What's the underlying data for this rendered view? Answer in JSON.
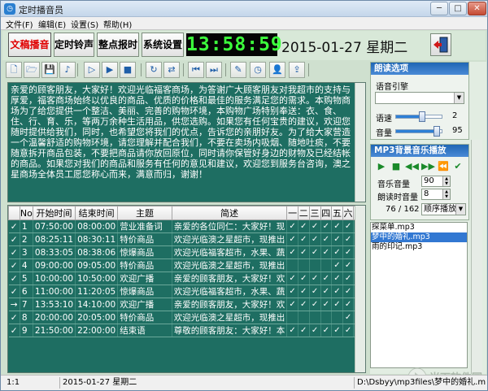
{
  "window": {
    "title": "定时播音员",
    "controls": [
      "minimize",
      "maximize",
      "close"
    ]
  },
  "menu": [
    "文件(F)",
    "编辑(E)",
    "设置(S)",
    "帮助(H)"
  ],
  "modes": {
    "tabs": [
      "文稿播音",
      "定时铃声",
      "整点报时",
      "系统设置"
    ],
    "active": "文稿播音",
    "active_color": "#e00000"
  },
  "clock": {
    "time": "13:58:59",
    "date": "2015-01-27 星期二",
    "digit_color": "#3cff3c"
  },
  "toolbar": {
    "icons": [
      "new-document-icon",
      "open-folder-icon",
      "save-icon",
      "music-note-icon",
      "play-step-icon",
      "play-icon",
      "stop-icon",
      "refresh-icon",
      "repeat-icon",
      "skip-back-icon",
      "skip-forward-icon",
      "edit-note-icon",
      "clock-icon",
      "user-icon",
      "export-icon"
    ]
  },
  "announcement": {
    "text": "亲爱的顾客朋友，大家好！欢迎光临福客商场，为答谢广大顾客朋友对我超市的支持与厚爱，福客商场始终以优良的商品、优质的价格和最佳的服务满足您的需求。本购物商场为了给您提供一个整洁、美丽、完善的购物环境，本购物广场特别奉送：衣、食、住、行、育、乐，等两万余种生活用品，供您选购。如果您有任何宝贵的建议，欢迎您随时提供给我们，同时，也希望您将我们的优点，告诉您的亲朋好友。为了给大家营造一个温馨舒适的购物环境，请您理解并配合我们，不要在卖场内吸烟、随地吐痰，不要随意拆开商品包装，不要把商品请你放回原位，同时请你保管好身边的财物及已经结帐的商品。如果您对我们的商品和服务有任何的意见和建议，欢迎您到服务台咨询，澳之星商场全体员工愿您称心而来，满意而归，谢谢！",
    "bg_color": "#1e6e62"
  },
  "schedule": {
    "columns": [
      "",
      "No",
      "开始时间",
      "结束时间",
      "主题",
      "简述",
      "一",
      "二",
      "三",
      "四",
      "五",
      "六",
      "日"
    ],
    "rows": [
      {
        "sel": "✓",
        "no": "1",
        "start": "07:50:00",
        "end": "08:00:00",
        "topic": "营业准备词",
        "summary": "亲爱的各位同仁：大家好！现",
        "days": [
          "✓",
          "✓",
          "✓",
          "✓",
          "✓",
          "✓",
          "✓"
        ]
      },
      {
        "sel": "✓",
        "no": "2",
        "start": "08:25:11",
        "end": "08:30:11",
        "topic": "特价商品",
        "summary": "欢迎光临澳之星超市，现推出",
        "days": [
          "✓",
          "✓",
          "✓",
          "✓",
          "✓",
          "✓",
          "✓"
        ]
      },
      {
        "sel": "✓",
        "no": "3",
        "start": "08:33:05",
        "end": "08:38:06",
        "topic": "惊爆商品",
        "summary": "欢迎光临福客超市，水果、蔬",
        "days": [
          "✓",
          "✓",
          "✓",
          "✓",
          "✓",
          "✓",
          "✓"
        ]
      },
      {
        "sel": "✓",
        "no": "4",
        "start": "09:00:00",
        "end": "09:05:00",
        "topic": "特价商品",
        "summary": "欢迎光临澳之星超市，现推出",
        "days": [
          "",
          "",
          "",
          "",
          "✓",
          "✓",
          "✓"
        ]
      },
      {
        "sel": "✓",
        "no": "5",
        "start": "10:00:00",
        "end": "10:50:00",
        "topic": "欢迎广播",
        "summary": "亲爱的顾客朋友，大家好！欢",
        "days": [
          "✓",
          "✓",
          "✓",
          "✓",
          "✓",
          "✓",
          "✓"
        ]
      },
      {
        "sel": "✓",
        "no": "6",
        "start": "11:00:00",
        "end": "11:20:05",
        "topic": "惊爆商品",
        "summary": "欢迎光临福客超市，水果、蔬",
        "days": [
          "✓",
          "✓",
          "✓",
          "✓",
          "✓",
          "✓",
          "✓"
        ]
      },
      {
        "sel": "→",
        "no": "7",
        "start": "13:53:10",
        "end": "14:10:00",
        "topic": "欢迎广播",
        "summary": "亲爱的顾客朋友，大家好！欢",
        "days": [
          "✓",
          "✓",
          "✓",
          "✓",
          "✓",
          "✓",
          "✓"
        ]
      },
      {
        "sel": "✓",
        "no": "8",
        "start": "20:00:00",
        "end": "20:05:00",
        "topic": "特价商品",
        "summary": "欢迎光临澳之星超市，现推出",
        "days": [
          "",
          "",
          "",
          "",
          "",
          "✓",
          "✓"
        ]
      },
      {
        "sel": "✓",
        "no": "9",
        "start": "21:50:00",
        "end": "22:00:00",
        "topic": "结束语",
        "summary": "尊敬的顾客朋友：大家好！本",
        "days": [
          "✓",
          "✓",
          "✓",
          "✓",
          "✓",
          "✓",
          "✓"
        ]
      }
    ]
  },
  "reading_options": {
    "title": "朗读选项",
    "engine_label": "语音引擎",
    "engine_value": "",
    "speed_label": "语速",
    "speed_value": "2",
    "speed_level": 0.55,
    "volume_label": "音量",
    "volume_value": "95",
    "volume_level": 0.92
  },
  "mp3": {
    "title": "MP3背景音乐播放",
    "music_volume_label": "音乐音量",
    "music_volume": "90",
    "reading_volume_label": "朗读时音量",
    "reading_volume": "8",
    "progress": "76 / 162",
    "progress_fraction": 0.47,
    "play_mode": "顺序播放",
    "files": [
      "探菜单.mp3",
      "梦中的婚礼.mp3",
      "雨的印记.mp3"
    ],
    "selected_index": 1
  },
  "status": {
    "position": "1:1",
    "date": "2015-01-27 星期二",
    "file_path": "D:\\Dsbyy\\mp3files\\梦中的婚礼.mp3"
  },
  "watermark": {
    "text": "当下软件园"
  }
}
